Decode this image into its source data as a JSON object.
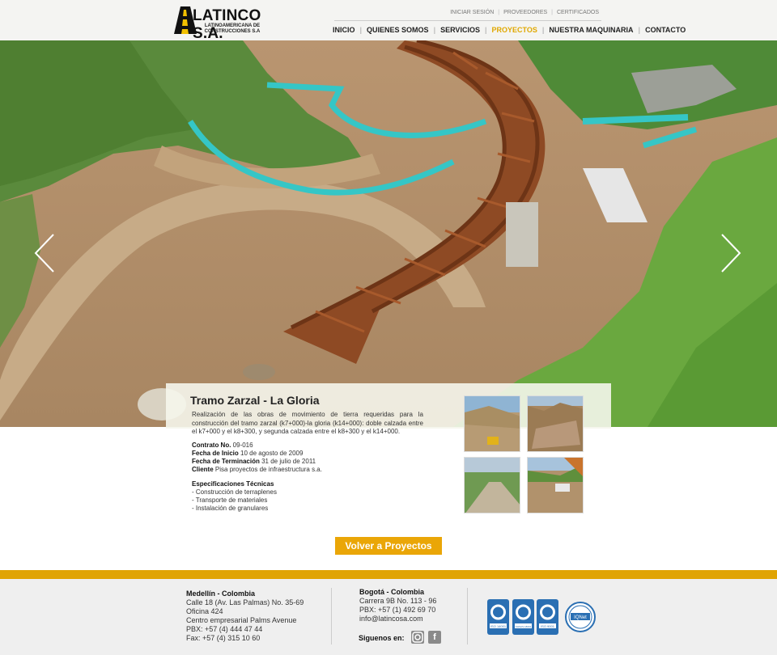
{
  "brand": {
    "name": "LATINCO S.A.",
    "subtitle": "LATINOAMERICANA DE CONSTRUCCIONES S.A"
  },
  "topnav": [
    "INICIAR SESIÓN",
    "PROVEEDORES",
    "CERTIFICADOS"
  ],
  "mainnav": [
    "INICIO",
    "QUIENES SOMOS",
    "SERVICIOS",
    "PROYECTOS",
    "NUESTRA MAQUINARIA",
    "CONTACTO"
  ],
  "active_nav": "PROYECTOS",
  "project": {
    "title": "Tramo Zarzal - La Gloria",
    "description": "Realización de las obras de movimiento de tierra requeridas para la construcción del tramo zarzal (k7+000)-la gloria (k14+000): doble calzada entre el k7+000 y el k8+300, y segunda calzada entre el k8+300 y el k14+000.",
    "contract_label": "Contrato No.",
    "contract_value": "09-016",
    "start_label": "Fecha de Inicio",
    "start_value": "10 de agosto de 2009",
    "end_label": "Fecha de Terminación",
    "end_value": "31 de julio de 2011",
    "client_label": "Cliente",
    "client_value": "Pisa proyectos de infraestructura s.a.",
    "specs_title": "Especificaciones Técnicas",
    "specs": [
      "- Construcción de terraplenes",
      "- Transporte de materiales",
      "- Instalación de granulares"
    ]
  },
  "back_button": "Volver a Proyectos",
  "footer": {
    "medellin": {
      "title": "Medellín - Colombia",
      "lines": [
        "Calle 18 (Av. Las Palmas) No. 35-69",
        "Oficina 424",
        "Centro empresarial Palms Avenue",
        "PBX: +57 (4) 444 47 44",
        "Fax: +57 (4) 315 10 60"
      ]
    },
    "bogota": {
      "title": "Bogotá - Colombia",
      "lines": [
        "Carrera 9B No. 113 - 96",
        "PBX: +57 (1) 492 69 70",
        "info@latincosa.com"
      ]
    },
    "follow_label": "Siguenos en:",
    "certifications": [
      "ISO 14001",
      "OHSAS 18001",
      "ISO 9001",
      "IQNet"
    ]
  },
  "colors": {
    "accent": "#e0a404",
    "button": "#eaa607",
    "active_nav": "#e0a800"
  },
  "icons": [
    "arrow-left-icon",
    "arrow-right-icon",
    "instagram-icon",
    "facebook-icon"
  ]
}
